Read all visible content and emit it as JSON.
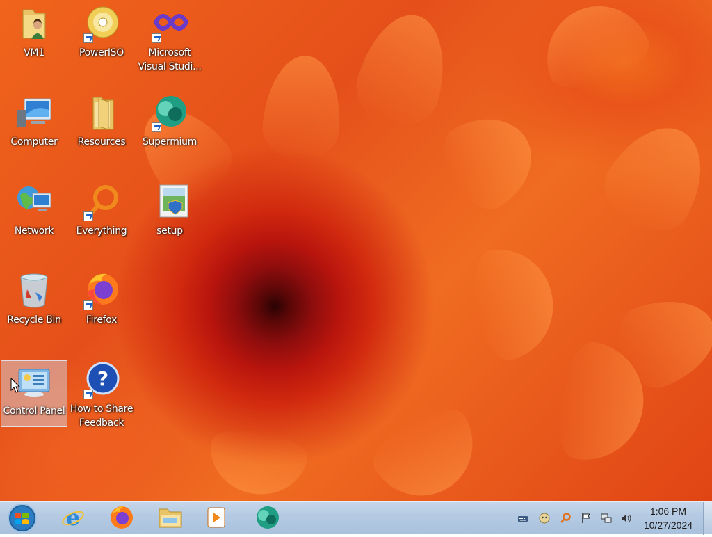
{
  "desktop": {
    "icons": [
      {
        "label": "VM1"
      },
      {
        "label": "PowerISO"
      },
      {
        "label": "Microsoft Visual Studi..."
      },
      {
        "label": "Computer"
      },
      {
        "label": "Resources"
      },
      {
        "label": "Supermium"
      },
      {
        "label": "Network"
      },
      {
        "label": "Everything"
      },
      {
        "label": "setup"
      },
      {
        "label": "Recycle Bin"
      },
      {
        "label": "Firefox"
      },
      {
        "label": "Control Panel"
      },
      {
        "label": "How to Share Feedback"
      }
    ],
    "selected_icon": "Control Panel",
    "wallpaper_colors": {
      "outer": "#f0641c",
      "center": "#2a0303",
      "mid": "#b9150d"
    }
  },
  "taskbar": {
    "start_button": {
      "icon": "windows-logo-icon"
    },
    "pinned": [
      {
        "icon": "internet-explorer-icon"
      },
      {
        "icon": "firefox-icon"
      },
      {
        "icon": "file-explorer-icon"
      },
      {
        "icon": "media-player-icon"
      },
      {
        "icon": "supermium-icon"
      }
    ],
    "tray": [
      {
        "icon": "keyboard-icon"
      },
      {
        "icon": "face-icon"
      },
      {
        "icon": "search-magnifier-icon"
      },
      {
        "icon": "action-center-flag-icon"
      },
      {
        "icon": "network-icon"
      },
      {
        "icon": "volume-icon"
      }
    ],
    "clock": {
      "time": "1:06 PM",
      "date": "10/27/2024"
    }
  }
}
